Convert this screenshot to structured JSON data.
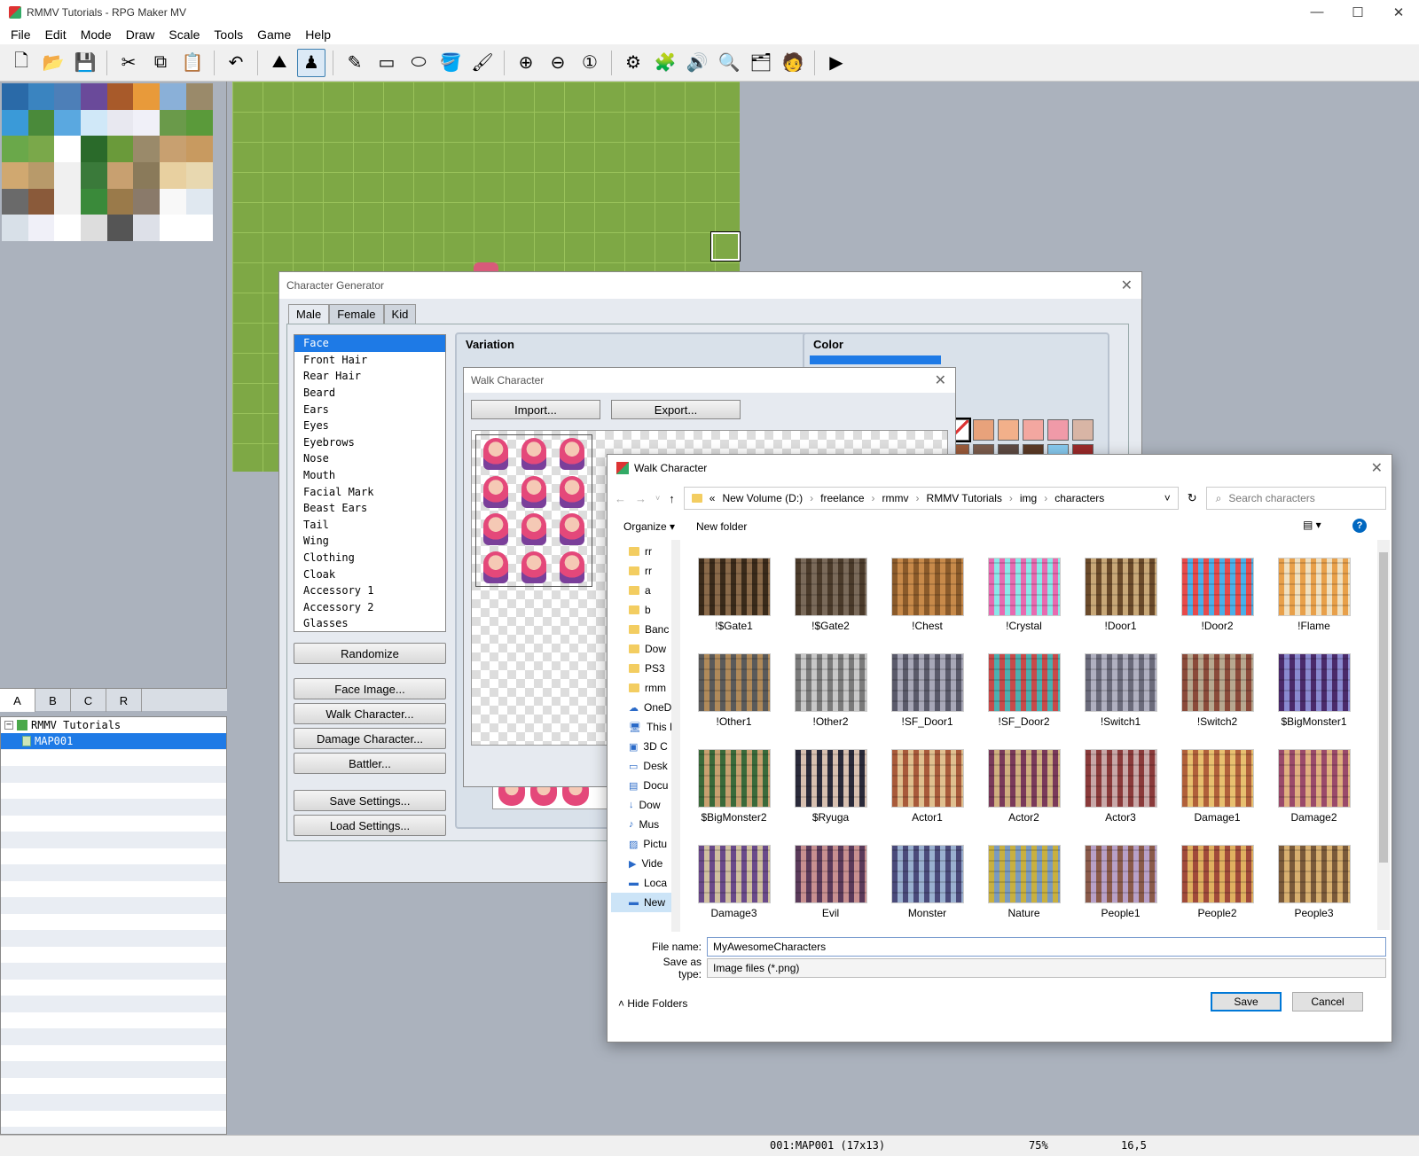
{
  "window": {
    "title": "RMMV Tutorials - RPG Maker MV",
    "controls": [
      "—",
      "☐",
      "✕"
    ]
  },
  "menu": [
    "File",
    "Edit",
    "Mode",
    "Draw",
    "Scale",
    "Tools",
    "Game",
    "Help"
  ],
  "toolbar": [
    {
      "name": "new-project-icon",
      "glyph": "🗋"
    },
    {
      "name": "open-project-icon",
      "glyph": "📂"
    },
    {
      "name": "save-project-icon",
      "glyph": "💾"
    },
    {
      "sep": true
    },
    {
      "name": "cut-icon",
      "glyph": "✂"
    },
    {
      "name": "copy-icon",
      "glyph": "⧉"
    },
    {
      "name": "paste-icon",
      "glyph": "📋"
    },
    {
      "sep": true
    },
    {
      "name": "undo-icon",
      "glyph": "↶"
    },
    {
      "sep": true
    },
    {
      "name": "map-mode-icon",
      "glyph": "⛰"
    },
    {
      "name": "event-mode-icon",
      "glyph": "♟",
      "active": true
    },
    {
      "sep": true
    },
    {
      "name": "pencil-icon",
      "glyph": "✎"
    },
    {
      "name": "rectangle-icon",
      "glyph": "▭"
    },
    {
      "name": "ellipse-icon",
      "glyph": "⬭"
    },
    {
      "name": "flood-fill-icon",
      "glyph": "🪣"
    },
    {
      "name": "shadow-pen-icon",
      "glyph": "🖌"
    },
    {
      "sep": true
    },
    {
      "name": "zoom-in-icon",
      "glyph": "⊕"
    },
    {
      "name": "zoom-out-icon",
      "glyph": "⊖"
    },
    {
      "name": "zoom-actual-icon",
      "glyph": "①"
    },
    {
      "sep": true
    },
    {
      "name": "database-icon",
      "glyph": "⚙"
    },
    {
      "name": "plugin-manager-icon",
      "glyph": "🧩"
    },
    {
      "name": "sound-test-icon",
      "glyph": "🔊"
    },
    {
      "name": "event-searcher-icon",
      "glyph": "🔍"
    },
    {
      "name": "resource-manager-icon",
      "glyph": "🗂"
    },
    {
      "name": "character-generator-icon",
      "glyph": "🧑"
    },
    {
      "sep": true
    },
    {
      "name": "playtest-icon",
      "glyph": "▶"
    }
  ],
  "layer_tabs": [
    "A",
    "B",
    "C",
    "R"
  ],
  "map_tree": {
    "project": "RMMV Tutorials",
    "map": "MAP001"
  },
  "status": {
    "map": "001:MAP001 (17x13)",
    "zoom": "75%",
    "coords": "16,5"
  },
  "chargen": {
    "title": "Character Generator",
    "tabs": [
      "Male",
      "Female",
      "Kid"
    ],
    "parts": [
      "Face",
      "Front Hair",
      "Rear Hair",
      "Beard",
      "Ears",
      "Eyes",
      "Eyebrows",
      "Nose",
      "Mouth",
      "Facial Mark",
      "Beast Ears",
      "Tail",
      "Wing",
      "Clothing",
      "Cloak",
      "Accessory 1",
      "Accessory 2",
      "Glasses"
    ],
    "buttons": {
      "randomize": "Randomize",
      "face_image": "Face Image...",
      "walk_character": "Walk Character...",
      "damage_character": "Damage Character...",
      "battler": "Battler...",
      "save_settings": "Save Settings...",
      "load_settings": "Load Settings..."
    },
    "variation_label": "Variation",
    "color_label": "Color",
    "swatches": [
      "#ffffff",
      "#e8a27b",
      "#f2b08a",
      "#f3a7a0",
      "#f09aa8",
      "#d8b5a5",
      "#9a5a3a",
      "#7c5c4c",
      "#5e4a42",
      "#5b3a26",
      "#86c9ee",
      "#9a2a2a",
      "#e8e0e8",
      "#8c8cf0",
      "#3a7a3a",
      "#e8a4e0",
      "#2a4a66",
      "#4a4e5a"
    ]
  },
  "walk": {
    "title": "Walk Character",
    "import": "Import...",
    "export": "Export..."
  },
  "save_dialog": {
    "title": "Walk Character",
    "path": [
      "«",
      "New Volume (D:)",
      "freelance",
      "rmmv",
      "RMMV Tutorials",
      "img",
      "characters"
    ],
    "search_placeholder": "Search characters",
    "organize": "Organize ▾",
    "new_folder": "New folder",
    "nav": [
      {
        "label": "rr",
        "icon": "folder"
      },
      {
        "label": "rr",
        "icon": "folder"
      },
      {
        "label": "a",
        "icon": "folder"
      },
      {
        "label": "b",
        "icon": "folder"
      },
      {
        "label": "Banc",
        "icon": "folder"
      },
      {
        "label": "Dow",
        "icon": "folder"
      },
      {
        "label": "PS3",
        "icon": "folder"
      },
      {
        "label": "rmm",
        "icon": "folder"
      },
      {
        "label": "OneD",
        "icon": "cloud"
      },
      {
        "label": "This P",
        "icon": "pc"
      },
      {
        "label": "3D C",
        "icon": "cube"
      },
      {
        "label": "Desk",
        "icon": "desk"
      },
      {
        "label": "Docu",
        "icon": "doc"
      },
      {
        "label": "Dow",
        "icon": "down"
      },
      {
        "label": "Mus",
        "icon": "music"
      },
      {
        "label": "Pictu",
        "icon": "pic"
      },
      {
        "label": "Vide",
        "icon": "video"
      },
      {
        "label": "Loca",
        "icon": "disk"
      },
      {
        "label": "New",
        "icon": "disk",
        "selected": true
      }
    ],
    "files": [
      {
        "name": "!$Gate1",
        "c1": "#3a2a1a",
        "c2": "#8a6a4a"
      },
      {
        "name": "!$Gate2",
        "c1": "#4a3a2a",
        "c2": "#7a6a5a"
      },
      {
        "name": "!Chest",
        "c1": "#8a5a2a",
        "c2": "#c88a4a"
      },
      {
        "name": "!Crystal",
        "c1": "#e86ab0",
        "c2": "#8ae8e8"
      },
      {
        "name": "!Door1",
        "c1": "#6a4a2a",
        "c2": "#c8a878"
      },
      {
        "name": "!Door2",
        "c1": "#e84a4a",
        "c2": "#4ab0e8"
      },
      {
        "name": "!Flame",
        "c1": "#e8a04a",
        "c2": "#f0e0c0"
      },
      {
        "name": "!Other1",
        "c1": "#5a5a5a",
        "c2": "#b08a5a"
      },
      {
        "name": "!Other2",
        "c1": "#7a7a7a",
        "c2": "#c8c8c8"
      },
      {
        "name": "!SF_Door1",
        "c1": "#5a5a6a",
        "c2": "#a8a8b8"
      },
      {
        "name": "!SF_Door2",
        "c1": "#c84a4a",
        "c2": "#4ab0b0"
      },
      {
        "name": "!Switch1",
        "c1": "#6a6a7a",
        "c2": "#b0b0c0"
      },
      {
        "name": "!Switch2",
        "c1": "#8a4a3a",
        "c2": "#b8a890"
      },
      {
        "name": "$BigMonster1",
        "c1": "#4a2a6a",
        "c2": "#8a8ad0"
      },
      {
        "name": "$BigMonster2",
        "c1": "#3a6a3a",
        "c2": "#c8a070"
      },
      {
        "name": "$Ryuga",
        "c1": "#2a2a3a",
        "c2": "#d8c0b0"
      },
      {
        "name": "Actor1",
        "c1": "#a85a3a",
        "c2": "#e0c090"
      },
      {
        "name": "Actor2",
        "c1": "#7a3a5a",
        "c2": "#d0b080"
      },
      {
        "name": "Actor3",
        "c1": "#8a3a3a",
        "c2": "#c8a8a8"
      },
      {
        "name": "Damage1",
        "c1": "#b0603a",
        "c2": "#e8c070"
      },
      {
        "name": "Damage2",
        "c1": "#9a4a6a",
        "c2": "#e0b080"
      },
      {
        "name": "Damage3",
        "c1": "#6a4a8a",
        "c2": "#d0c0a0"
      },
      {
        "name": "Evil",
        "c1": "#5a3a5a",
        "c2": "#c89090"
      },
      {
        "name": "Monster",
        "c1": "#4a4a7a",
        "c2": "#9ab0d0"
      },
      {
        "name": "Nature",
        "c1": "#c8b040",
        "c2": "#7a9ac0"
      },
      {
        "name": "People1",
        "c1": "#8a5a4a",
        "c2": "#b8a0c8"
      },
      {
        "name": "People2",
        "c1": "#a04a3a",
        "c2": "#e0b060"
      },
      {
        "name": "People3",
        "c1": "#7a5a3a",
        "c2": "#d8b070"
      }
    ],
    "file_name_label": "File name:",
    "file_name": "MyAwesomeCharacters",
    "type_label": "Save as type:",
    "type_value": "Image files (*.png)",
    "hide_folders": "Hide Folders",
    "save": "Save",
    "cancel": "Cancel"
  }
}
